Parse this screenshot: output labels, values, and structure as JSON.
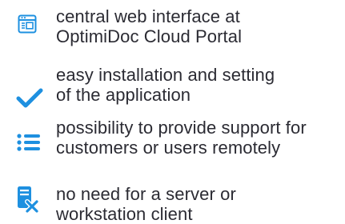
{
  "features": [
    {
      "icon": "web-window-icon",
      "line1": "central web interface at",
      "line2": "OptimiDoc Cloud Portal"
    },
    {
      "icon": "checkmark-icon",
      "line1": "easy installation and setting",
      "line2": "of the application"
    },
    {
      "icon": "list-icon",
      "line1": "possibility to provide support for",
      "line2": "customers or users remotely"
    },
    {
      "icon": "no-server-icon",
      "line1": "no need for a server or",
      "line2": "workstation client"
    }
  ],
  "colors": {
    "accent": "#1e90e0",
    "text": "#2b2b33"
  }
}
